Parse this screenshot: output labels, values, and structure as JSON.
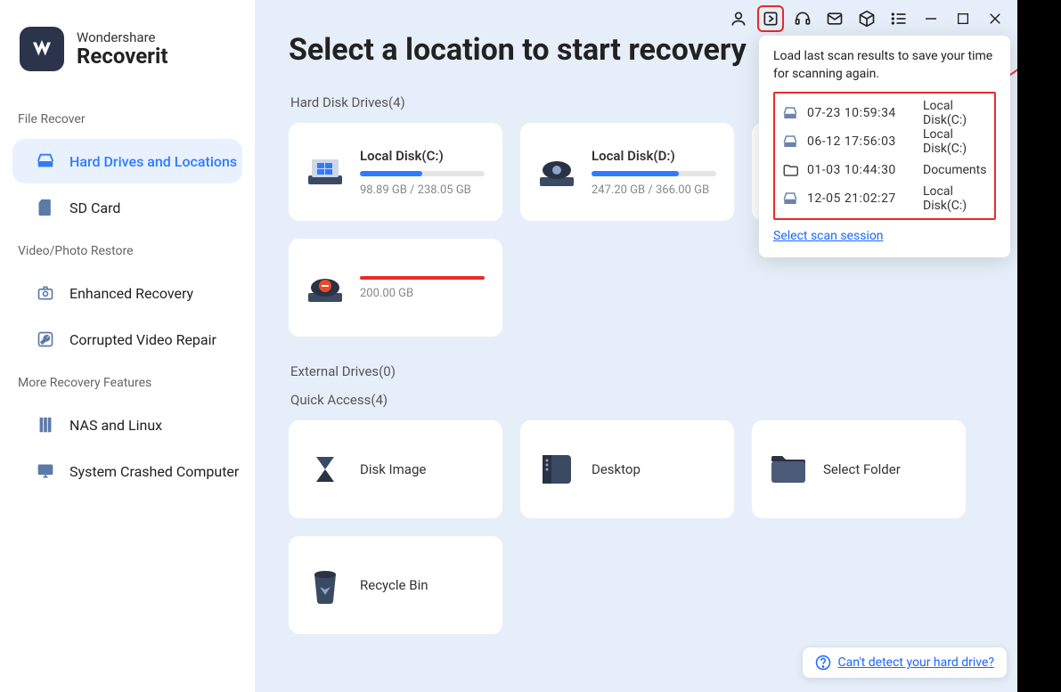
{
  "brand": {
    "top": "Wondershare",
    "name": "Recoverit"
  },
  "sidebar": {
    "sections": [
      {
        "label": "File Recover",
        "items": [
          {
            "label": "Hard Drives and Locations",
            "icon": "drive",
            "active": true
          },
          {
            "label": "SD Card",
            "icon": "sdcard"
          }
        ]
      },
      {
        "label": "Video/Photo Restore",
        "items": [
          {
            "label": "Enhanced Recovery",
            "icon": "camera"
          },
          {
            "label": "Corrupted Video Repair",
            "icon": "wrench"
          }
        ]
      },
      {
        "label": "More Recovery Features",
        "items": [
          {
            "label": "NAS and Linux",
            "icon": "server"
          },
          {
            "label": "System Crashed Computer",
            "icon": "monitor"
          }
        ]
      }
    ]
  },
  "page": {
    "title": "Select a location to start recovery",
    "hdd_head": "Hard Disk Drives(4)",
    "ext_head": "External Drives(0)",
    "qa_head": "Quick Access(4)"
  },
  "drives": [
    {
      "name": "Local Disk(C:)",
      "size": "98.89 GB / 238.05 GB",
      "fill": 50,
      "icon": "win"
    },
    {
      "name": "Local Disk(D:)",
      "size": "247.20 GB / 366.00 GB",
      "fill": 70,
      "icon": "hdd"
    },
    {
      "name": "",
      "size": "",
      "fill": 0,
      "icon": "hdd",
      "hidden_by_popup": true
    },
    {
      "name": "",
      "size": "200.00 GB",
      "fill": 0,
      "icon": "lost",
      "lost": true
    }
  ],
  "quick": [
    {
      "label": "Disk Image",
      "icon": "diskimage"
    },
    {
      "label": "Desktop",
      "icon": "desktop"
    },
    {
      "label": "Select Folder",
      "icon": "folder"
    },
    {
      "label": "Recycle Bin",
      "icon": "bin"
    }
  ],
  "popup": {
    "title": "Load last scan results to save your time for scanning again.",
    "rows": [
      {
        "time": "07-23  10:59:34",
        "loc": "Local Disk(C:)",
        "icon": "drive"
      },
      {
        "time": "06-12  17:56:03",
        "loc": "Local Disk(C:)",
        "icon": "drive"
      },
      {
        "time": "01-03  10:44:30",
        "loc": "Documents",
        "icon": "folder"
      },
      {
        "time": "12-05  21:02:27",
        "loc": "Local Disk(C:)",
        "icon": "drive"
      }
    ],
    "link": "Select scan session"
  },
  "help": {
    "text": "Can't detect your hard drive?"
  }
}
